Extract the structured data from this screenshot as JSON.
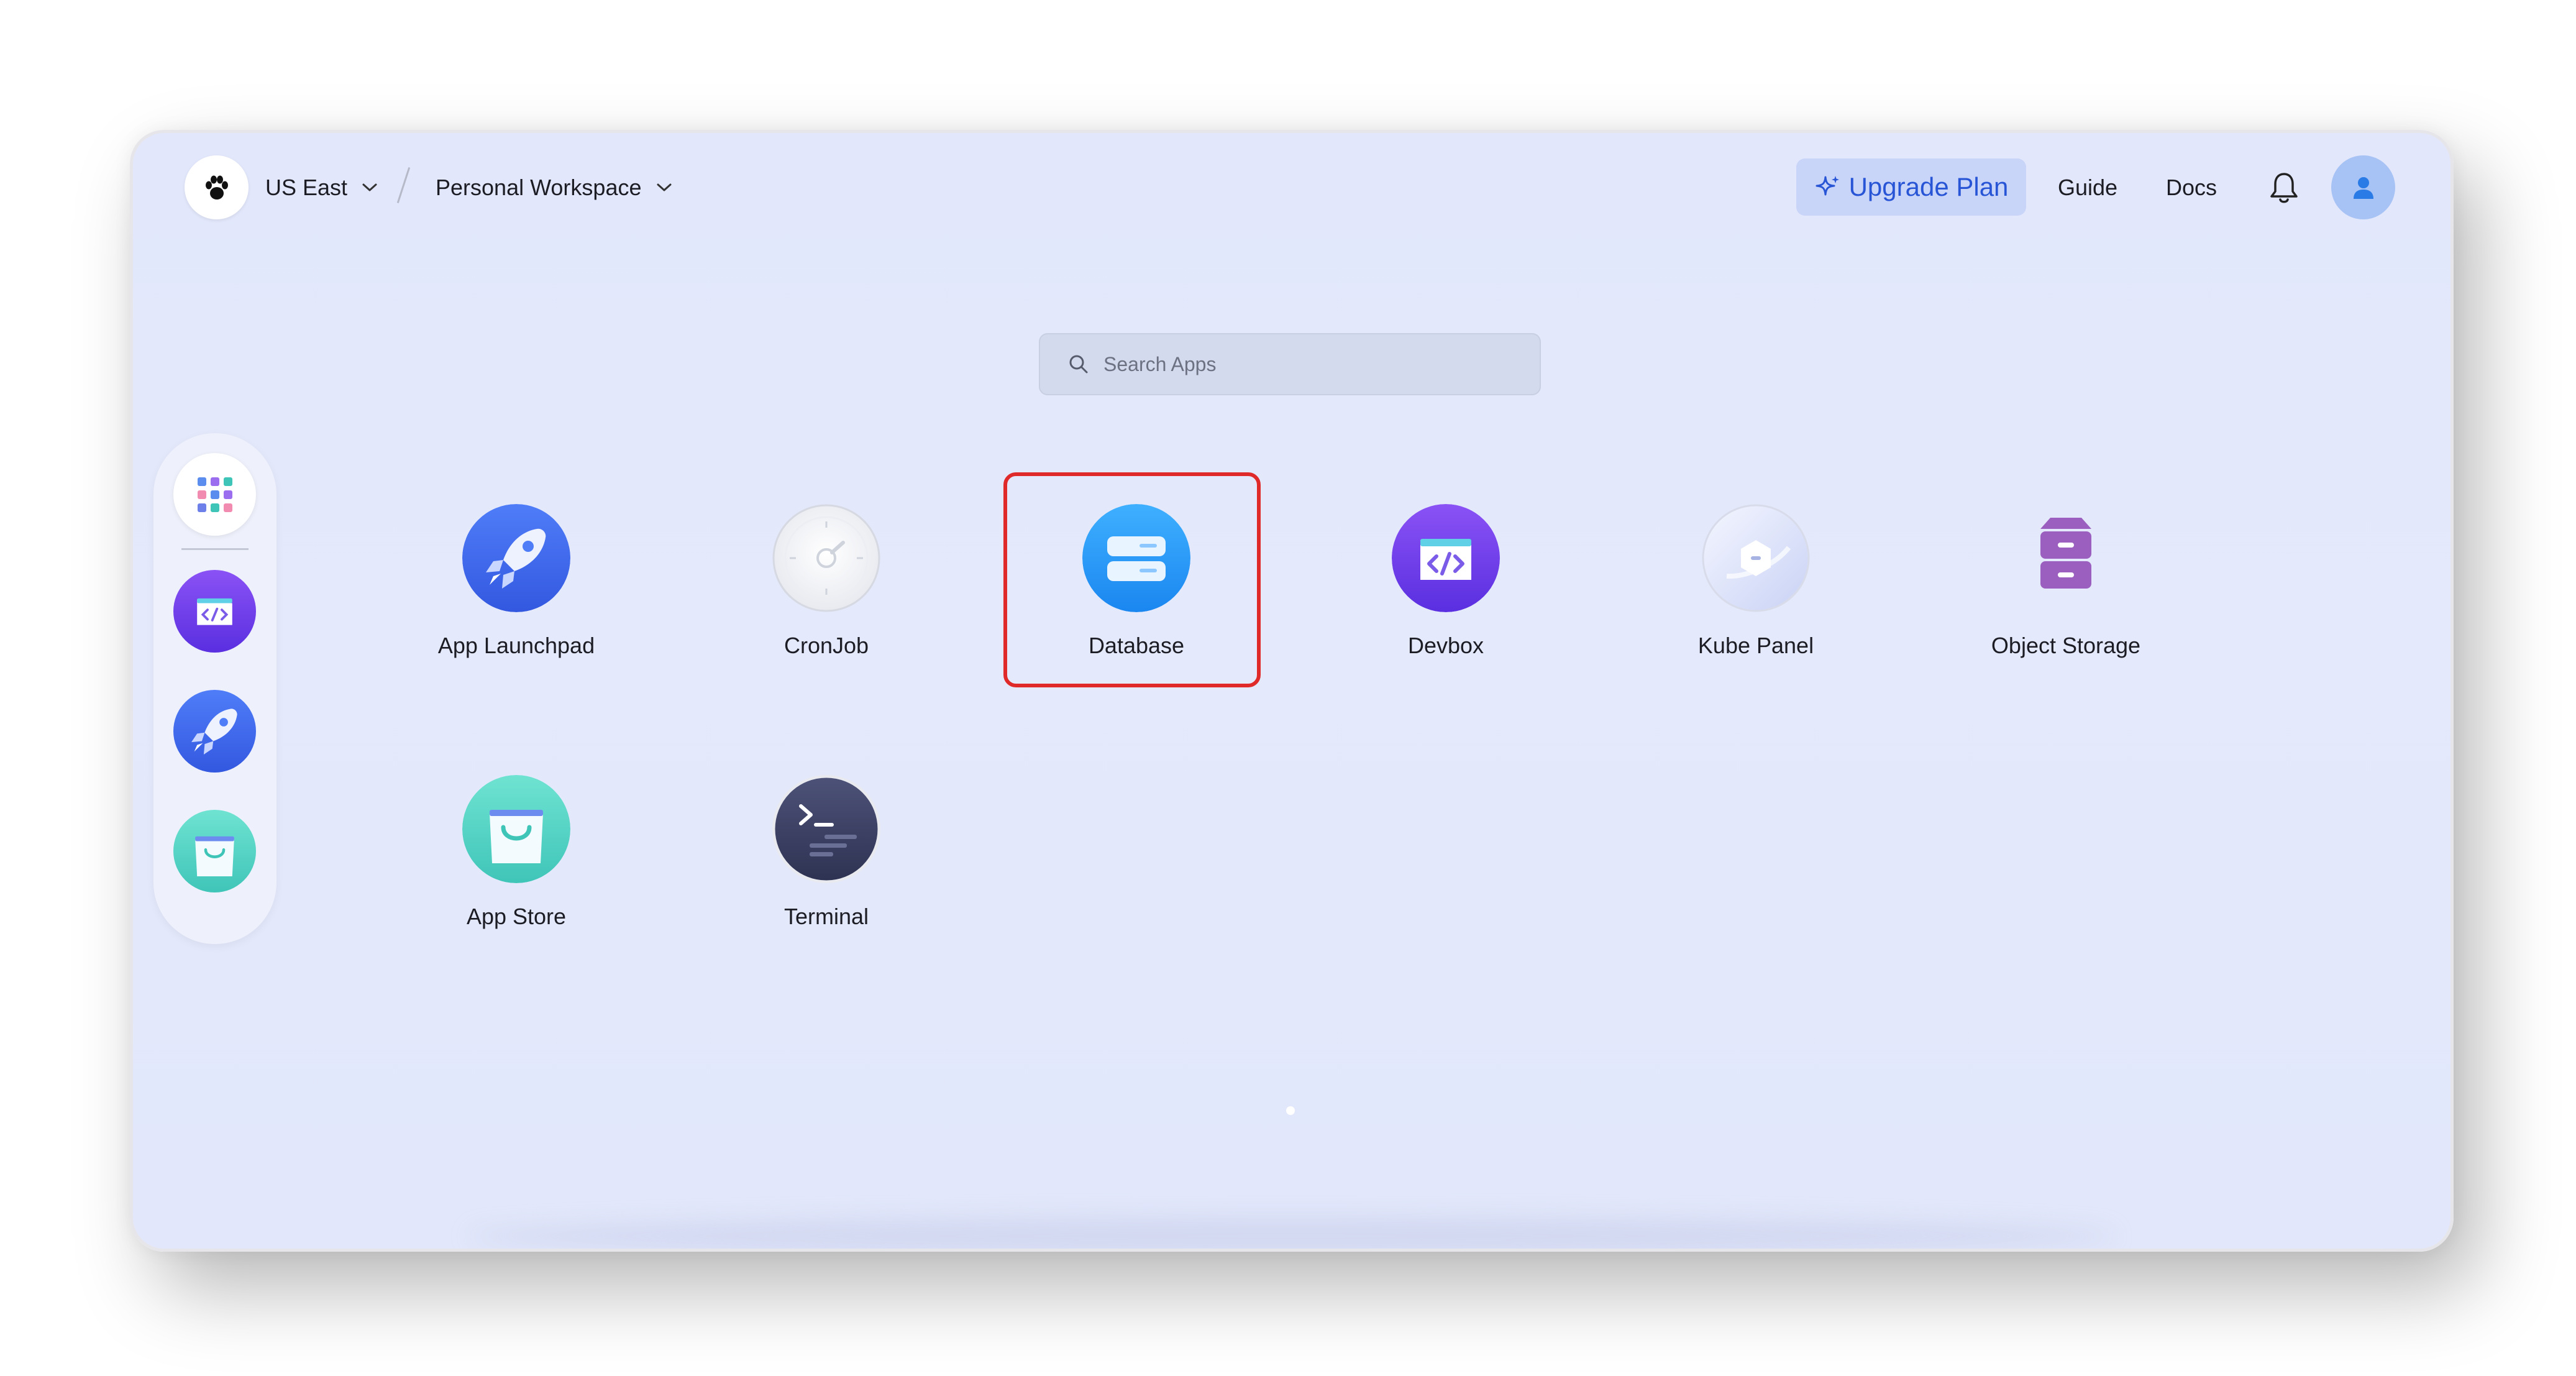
{
  "header": {
    "region": "US East",
    "workspace": "Personal Workspace",
    "upgrade_label": "Upgrade Plan",
    "guide_label": "Guide",
    "docs_label": "Docs"
  },
  "search": {
    "placeholder": "Search Apps"
  },
  "apps": [
    {
      "label": "App Launchpad",
      "icon": "rocket-icon"
    },
    {
      "label": "CronJob",
      "icon": "clock-icon"
    },
    {
      "label": "Database",
      "icon": "database-icon"
    },
    {
      "label": "Devbox",
      "icon": "code-folder-icon"
    },
    {
      "label": "Kube Panel",
      "icon": "hexagon-icon"
    },
    {
      "label": "Object Storage",
      "icon": "storage-drawers-icon"
    },
    {
      "label": "App Store",
      "icon": "shopping-bag-icon"
    },
    {
      "label": "Terminal",
      "icon": "terminal-icon"
    }
  ],
  "dock": [
    "apps-grid-icon",
    "code-folder-icon",
    "rocket-icon",
    "shopping-bag-icon"
  ],
  "colors": {
    "accent": "#2855d6",
    "highlight": "#e02a2a",
    "background": "#e2e7fb"
  }
}
